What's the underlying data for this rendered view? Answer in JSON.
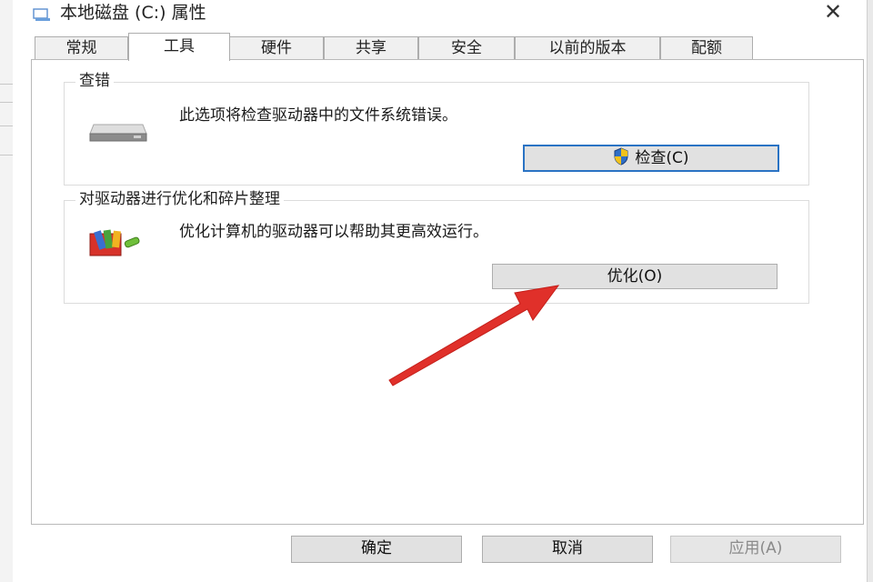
{
  "window": {
    "title": "本地磁盘 (C:) 属性",
    "close_glyph": "✕"
  },
  "tabs": [
    {
      "label": "常规",
      "active": false
    },
    {
      "label": "工具",
      "active": true
    },
    {
      "label": "硬件",
      "active": false
    },
    {
      "label": "共享",
      "active": false
    },
    {
      "label": "安全",
      "active": false
    },
    {
      "label": "以前的版本",
      "active": false
    },
    {
      "label": "配额",
      "active": false
    }
  ],
  "error_check": {
    "title": "查错",
    "description": "此选项将检查驱动器中的文件系统错误。",
    "button_label": "检查(C)",
    "icon": "drive-icon"
  },
  "optimize": {
    "title": "对驱动器进行优化和碎片整理",
    "description": "优化计算机的驱动器可以帮助其更高效运行。",
    "button_label": "优化(O)",
    "icon": "defrag-icon"
  },
  "footer": {
    "ok_label": "确定",
    "cancel_label": "取消",
    "apply_label": "应用(A)"
  },
  "annotation": {
    "arrow_color": "#e0302a",
    "arrow_target": "optimize-button"
  },
  "colors": {
    "focus_border": "#2a73c4",
    "button_face": "#e1e1e1",
    "panel_border": "#b9b9b9"
  }
}
